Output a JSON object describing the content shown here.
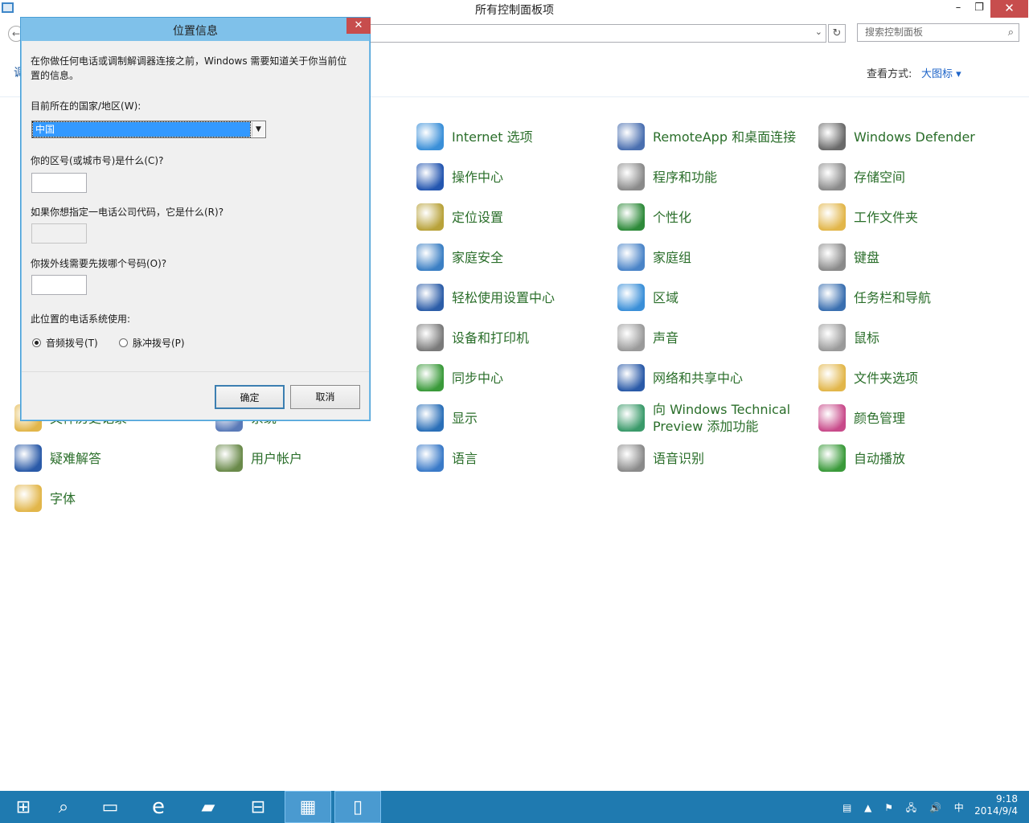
{
  "window": {
    "title": "所有控制面板项",
    "minimize": "–",
    "restore": "❐",
    "close": "✕",
    "back": "←",
    "search_placeholder": "搜索控制面板",
    "refresh": "↻",
    "view_by_label": "查看方式:",
    "view_by_value": "大图标 ▾",
    "breadcrumb": "调"
  },
  "items": [
    {
      "label": "Internet 选项",
      "icon": "internet-options-icon",
      "color": "#3a8fd8"
    },
    {
      "label": "RemoteApp 和桌面连接",
      "icon": "remoteapp-icon",
      "color": "#4a6fb0"
    },
    {
      "label": "Windows Defender",
      "icon": "defender-icon",
      "color": "#6a6a6a"
    },
    {
      "label": "操作中心",
      "icon": "action-center-flag-icon",
      "color": "#2456b0"
    },
    {
      "label": "程序和功能",
      "icon": "programs-icon",
      "color": "#8a8a8a"
    },
    {
      "label": "存储空间",
      "icon": "storage-spaces-icon",
      "color": "#8a8a8a"
    },
    {
      "label": "定位设置",
      "icon": "location-settings-icon",
      "color": "#b8a23a"
    },
    {
      "label": "个性化",
      "icon": "personalization-icon",
      "color": "#2e8a3a"
    },
    {
      "label": "工作文件夹",
      "icon": "work-folders-icon",
      "color": "#e2b64a"
    },
    {
      "label": "家庭安全",
      "icon": "family-safety-icon",
      "color": "#3b7fc4"
    },
    {
      "label": "家庭组",
      "icon": "homegroup-icon",
      "color": "#4a84c8"
    },
    {
      "label": "键盘",
      "icon": "keyboard-icon",
      "color": "#8a8a8a"
    },
    {
      "label": "轻松使用设置中心",
      "icon": "ease-of-access-icon",
      "color": "#2c5da8"
    },
    {
      "label": "区域",
      "icon": "region-icon",
      "color": "#3a8fd8"
    },
    {
      "label": "任务栏和导航",
      "icon": "taskbar-navigation-icon",
      "color": "#3a6fb0"
    },
    {
      "label": "设备和打印机",
      "icon": "devices-printers-icon",
      "color": "#7a7a7a"
    },
    {
      "label": "声音",
      "icon": "sound-icon",
      "color": "#9a9a9a"
    },
    {
      "label": "鼠标",
      "icon": "mouse-icon",
      "color": "#9a9a9a"
    },
    {
      "label": "同步中心",
      "icon": "sync-center-icon",
      "color": "#3a9a3a"
    },
    {
      "label": "网络和共享中心",
      "icon": "network-sharing-icon",
      "color": "#2a5aa8"
    },
    {
      "label": "文件夹选项",
      "icon": "folder-options-icon",
      "color": "#e2b64a"
    },
    {
      "label": "显示",
      "icon": "display-icon",
      "color": "#2a6fb8"
    },
    {
      "label": "向 Windows Technical Preview 添加功能",
      "icon": "add-features-icon",
      "color": "#3a9a6a"
    },
    {
      "label": "颜色管理",
      "icon": "color-management-icon",
      "color": "#c84a8a"
    },
    {
      "label": "疑难解答",
      "icon": "troubleshooting-icon",
      "color": "#2a5aa8"
    },
    {
      "label": "用户帐户",
      "icon": "user-accounts-icon",
      "color": "#6a8a4a"
    },
    {
      "label": "语言",
      "icon": "language-icon",
      "color": "#3a7ac8"
    },
    {
      "label": "语音识别",
      "icon": "speech-recognition-icon",
      "color": "#8a8a8a"
    },
    {
      "label": "自动播放",
      "icon": "autoplay-icon",
      "color": "#3a9a3a"
    },
    {
      "label": "字体",
      "icon": "fonts-icon",
      "color": "#e2b64a"
    },
    {
      "label": "文件历史记录",
      "icon": "file-history-icon",
      "color": "#e2b64a"
    },
    {
      "label": "系统",
      "icon": "system-icon",
      "color": "#5a7ab8"
    }
  ],
  "dialog": {
    "title": "位置信息",
    "close": "✕",
    "intro": "在你做任何电话或调制解调器连接之前，Windows 需要知道关于你当前位置的信息。",
    "country_label": "目前所在的国家/地区(W):",
    "country_value": "中国",
    "area_code_label": "你的区号(或城市号)是什么(C)?",
    "area_code_value": "",
    "carrier_label": "如果你想指定一电话公司代码，它是什么(R)?",
    "carrier_value": "",
    "outside_line_label": "你拨外线需要先拨哪个号码(O)?",
    "outside_line_value": "",
    "dial_type_label": "此位置的电话系统使用:",
    "tone_label": "音频拨号(T)",
    "pulse_label": "脉冲拨号(P)",
    "tone_selected": true,
    "ok_label": "确定",
    "cancel_label": "取消"
  },
  "taskbar": {
    "apps": [
      "start-icon",
      "search-icon",
      "task-view-icon",
      "internet-explorer-icon",
      "file-explorer-icon",
      "store-icon",
      "control-panel-icon",
      "document-icon"
    ],
    "tray_icons": "▤ ▲ ⚑ 🖧 🔊 中",
    "time": "9:18",
    "date": "2014/9/4",
    "accent": "#1f7ab0"
  }
}
